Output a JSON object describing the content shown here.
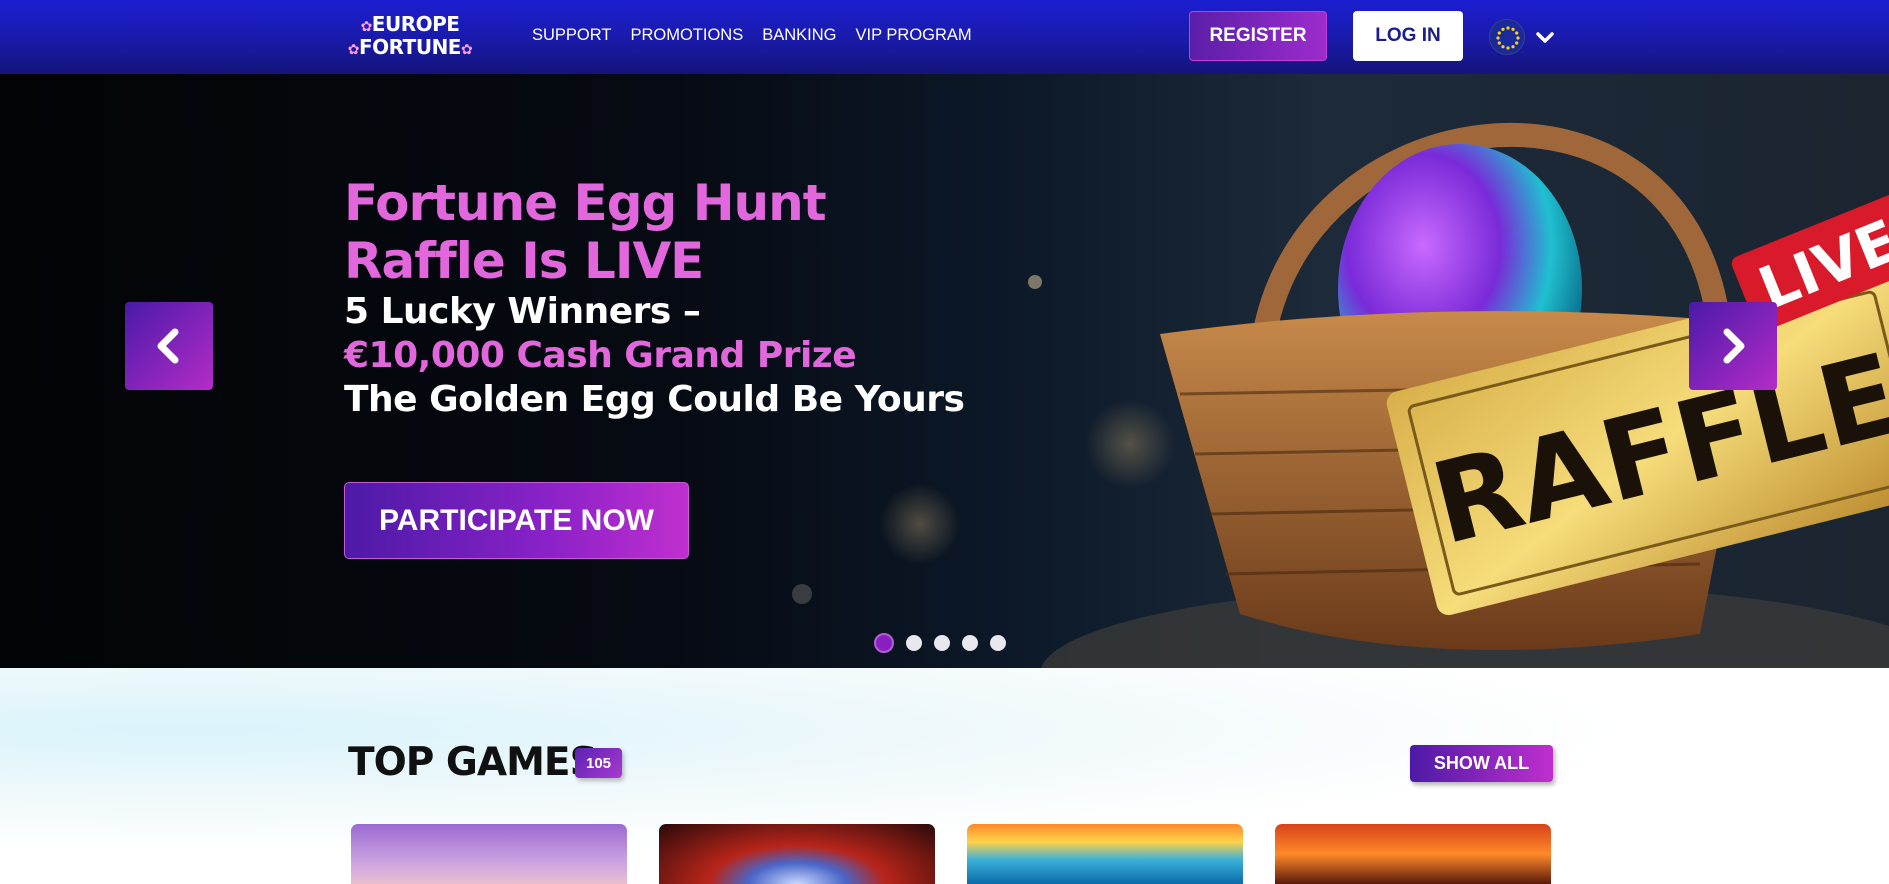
{
  "header": {
    "logo": {
      "line1": "EUROPE",
      "line2": "FORTUNE"
    },
    "nav": [
      "SUPPORT",
      "PROMOTIONS",
      "BANKING",
      "VIP PROGRAM"
    ],
    "register_label": "REGISTER",
    "login_label": "LOG IN",
    "language_icon": "eu-flag-icon"
  },
  "hero": {
    "title_line1": "Fortune Egg Hunt",
    "title_line2": "Raffle Is LIVE",
    "sub_line1": "5 Lucky Winners –",
    "sub_line2": "€10,000 Cash Grand Prize",
    "sub_line3": "The Golden Egg Could Be Yours",
    "cta_label": "PARTICIPATE NOW",
    "ticket_text": "RAFFLE",
    "live_tag": "LIVE",
    "slides_total": 5,
    "active_slide": 1
  },
  "top_games": {
    "title": "TOP GAMES",
    "count": "105",
    "show_all_label": "SHOW ALL"
  },
  "colors": {
    "header_blue": "#1a1aa8",
    "accent_purple": "#8b22c8",
    "accent_pink": "#e267dc"
  }
}
